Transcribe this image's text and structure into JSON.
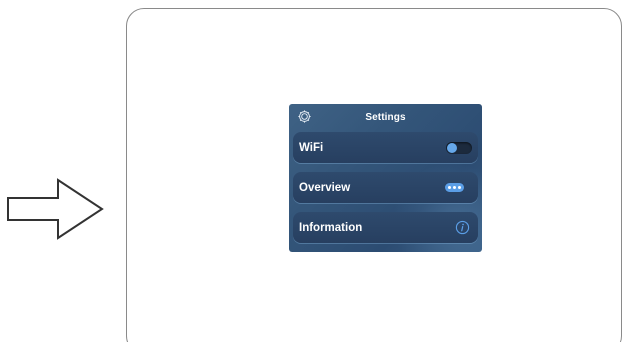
{
  "panel": {
    "title": "Settings",
    "items": [
      {
        "label": "WiFi",
        "control": "toggle",
        "toggle_on": false
      },
      {
        "label": "Overview",
        "control": "more-icon"
      },
      {
        "label": "Information",
        "control": "info-icon"
      }
    ]
  },
  "icons": {
    "header": "gear-icon",
    "pointer": "right-arrow-icon"
  },
  "colors": {
    "panel_background": "#34567a",
    "row_background": "#2a4466",
    "accent": "#5b9ee6",
    "text": "#ffffff"
  }
}
